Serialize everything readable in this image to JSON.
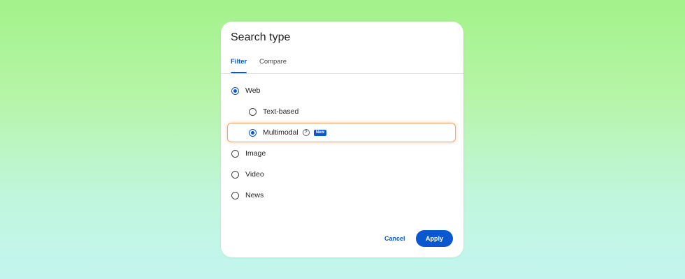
{
  "dialog": {
    "title": "Search type",
    "tabs": [
      {
        "label": "Filter",
        "active": true
      },
      {
        "label": "Compare",
        "active": false
      }
    ],
    "options": [
      {
        "id": "web",
        "label": "Web",
        "checked": true
      },
      {
        "id": "text-based",
        "label": "Text-based",
        "checked": false
      },
      {
        "id": "multimodal",
        "label": "Multimodal",
        "checked": true,
        "badge": "New",
        "help_icon": "question-circle-icon"
      },
      {
        "id": "image",
        "label": "Image",
        "checked": false
      },
      {
        "id": "video",
        "label": "Video",
        "checked": false
      },
      {
        "id": "news",
        "label": "News",
        "checked": false
      }
    ],
    "buttons": {
      "cancel_label": "Cancel",
      "apply_label": "Apply"
    }
  },
  "colors": {
    "accent": "#0b57d0",
    "highlight_border": "#f4a46a",
    "background_top": "#a3f28a",
    "background_bottom": "#c3f5ef"
  }
}
